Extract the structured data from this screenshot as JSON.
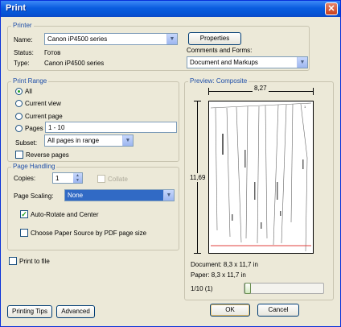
{
  "window": {
    "title": "Print",
    "close": "✕"
  },
  "printer": {
    "group_label": "Printer",
    "name_label": "Name:",
    "name_value": "Canon iP4500 series",
    "properties_label": "Properties",
    "status_label": "Status:",
    "status_value": "Готов",
    "type_label": "Type:",
    "type_value": "Canon iP4500 series",
    "comments_label": "Comments and Forms:",
    "comments_value": "Document and Markups"
  },
  "print_range": {
    "group_label": "Print Range",
    "options": [
      "All",
      "Current view",
      "Current page",
      "Pages"
    ],
    "selected": "All",
    "pages_value": "1 - 10",
    "subset_label": "Subset:",
    "subset_value": "All pages in range",
    "reverse_label": "Reverse pages",
    "reverse_checked": false
  },
  "page_handling": {
    "group_label": "Page Handling",
    "copies_label": "Copies:",
    "copies_value": "1",
    "collate_label": "Collate",
    "scaling_label": "Page Scaling:",
    "scaling_value": "None",
    "auto_rotate_label": "Auto-Rotate and Center",
    "auto_rotate_checked": true,
    "paper_source_label": "Choose Paper Source by PDF page size",
    "paper_source_checked": false
  },
  "print_to_file": {
    "label": "Print to file",
    "checked": false
  },
  "preview": {
    "label": "Preview: Composite",
    "width_label": "8,27",
    "height_label": "11,69",
    "document_size": "Document: 8,3 x 11,7 in",
    "paper_size": "Paper: 8,3 x 11,7 in",
    "page_indicator": "1/10 (1)",
    "slider_position": 0.0
  },
  "buttons": {
    "printing_tips": "Printing Tips",
    "advanced": "Advanced",
    "ok": "OK",
    "cancel": "Cancel"
  },
  "colors": {
    "title_bar": "#0a5ddf",
    "group_label": "#1e4ea8",
    "selection": "#316ac5",
    "checkmark": "#21a121"
  }
}
